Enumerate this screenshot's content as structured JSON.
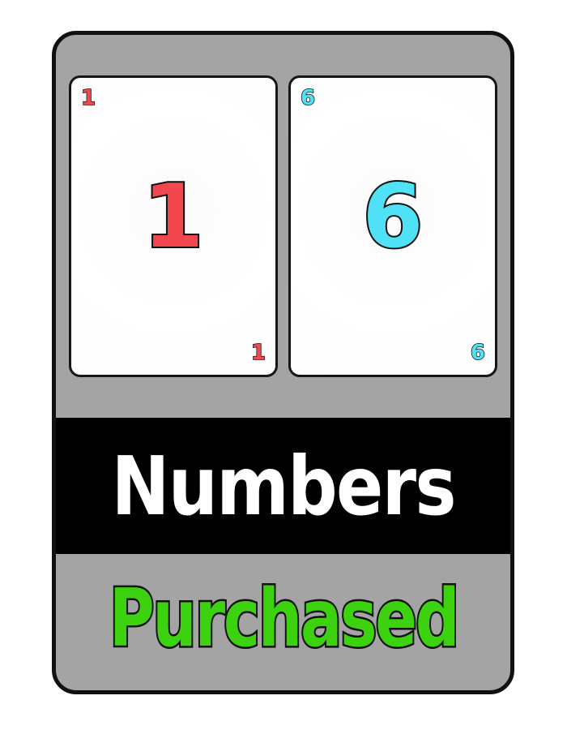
{
  "cards": [
    {
      "value": "1",
      "color": "#f2474f"
    },
    {
      "value": "6",
      "color": "#4fe1f5"
    }
  ],
  "label": "Numbers",
  "status": "Purchased",
  "colors": {
    "panel": "#a4a4a4",
    "label_bar": "#000000",
    "status": "#3dd20f"
  }
}
